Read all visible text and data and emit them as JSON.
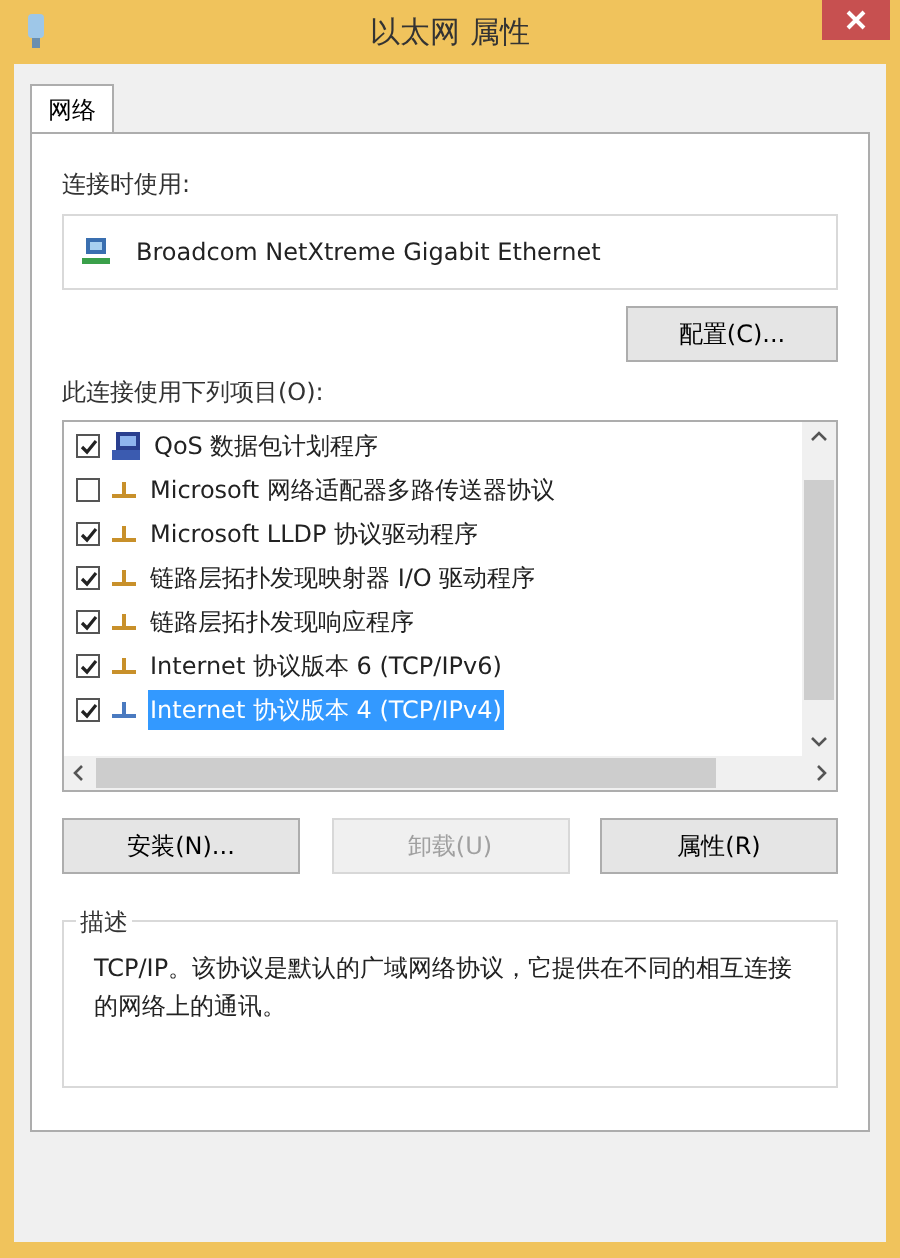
{
  "window": {
    "title": "以太网 属性"
  },
  "tabs": [
    {
      "label": "网络",
      "selected": true
    }
  ],
  "connect_using": {
    "label": "连接时使用:",
    "adapter": "Broadcom NetXtreme Gigabit Ethernet",
    "configure_button": "配置(C)..."
  },
  "items_label": "此连接使用下列项目(O):",
  "items": [
    {
      "kind": "service",
      "label": "QoS 数据包计划程序",
      "checked": true,
      "selected": false
    },
    {
      "kind": "protocol",
      "label": "Microsoft 网络适配器多路传送器协议",
      "checked": false,
      "selected": false
    },
    {
      "kind": "protocol",
      "label": "Microsoft LLDP 协议驱动程序",
      "checked": true,
      "selected": false
    },
    {
      "kind": "protocol",
      "label": "链路层拓扑发现映射器 I/O 驱动程序",
      "checked": true,
      "selected": false
    },
    {
      "kind": "protocol",
      "label": "链路层拓扑发现响应程序",
      "checked": true,
      "selected": false
    },
    {
      "kind": "protocol",
      "label": "Internet 协议版本 6 (TCP/IPv6)",
      "checked": true,
      "selected": false
    },
    {
      "kind": "protocol",
      "label": "Internet 协议版本 4 (TCP/IPv4)",
      "checked": true,
      "selected": true
    }
  ],
  "buttons": [
    {
      "label": "安装(N)...",
      "disabled": false
    },
    {
      "label": "卸载(U)",
      "disabled": true
    },
    {
      "label": "属性(R)",
      "disabled": false
    }
  ],
  "description": {
    "legend": "描述",
    "text": "TCP/IP。该协议是默认的广域网络协议，它提供在不同的相互连接的网络上的通讯。"
  }
}
